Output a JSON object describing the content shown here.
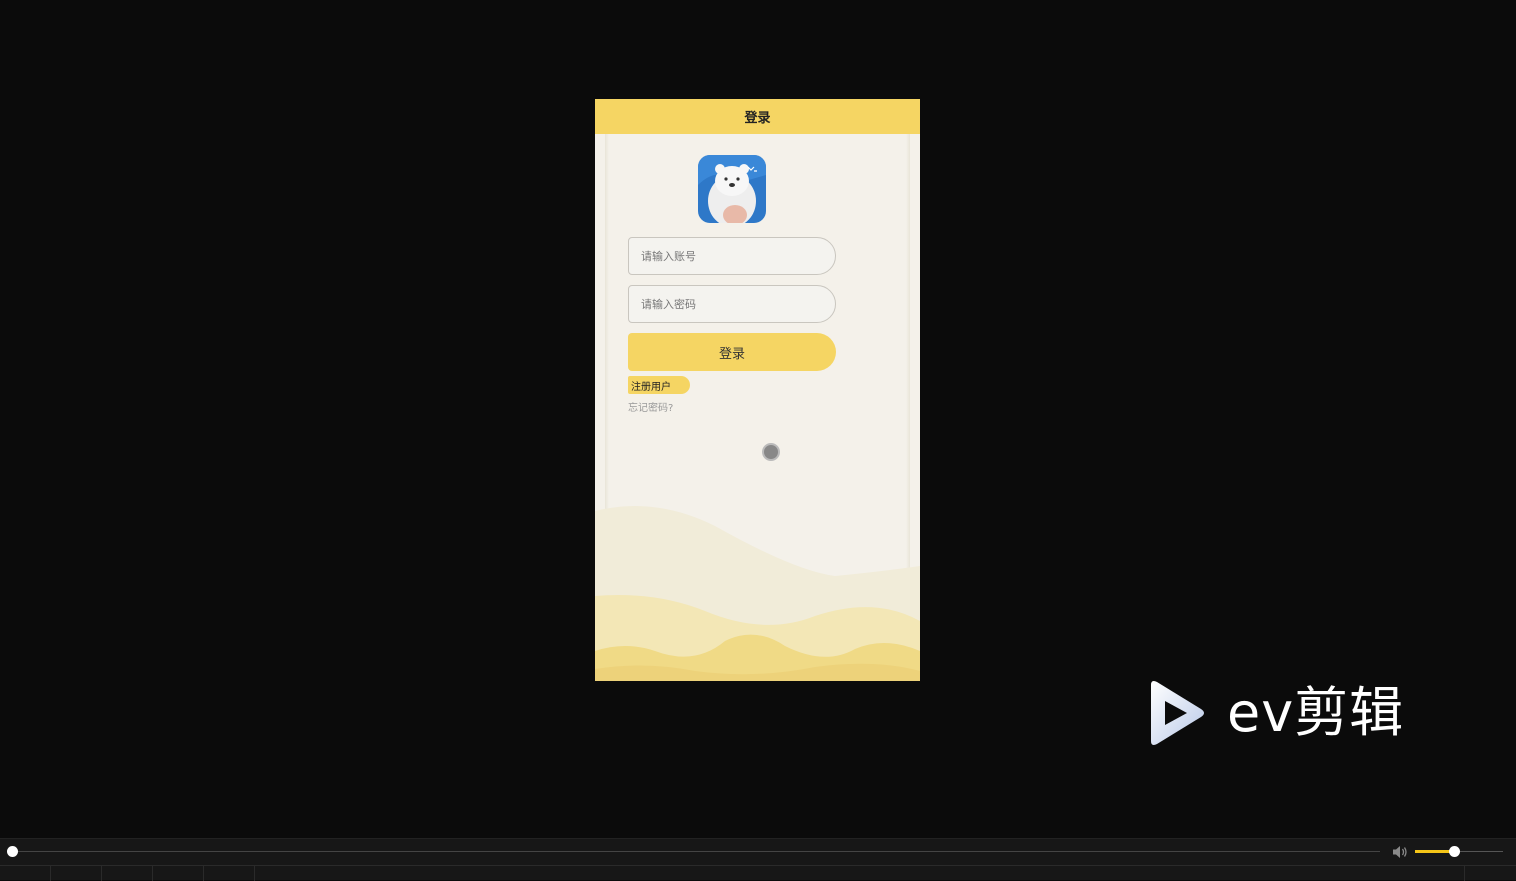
{
  "app": {
    "header_title": "登录",
    "account_placeholder": "请输入账号",
    "password_placeholder": "请输入密码",
    "login_label": "登录",
    "register_label": "注册用户",
    "forgot_label": "忘记密码?",
    "accent_color": "#f5d563",
    "avatar_icon": "polar-bear-icon"
  },
  "watermark": {
    "text": "ev剪辑",
    "logo_icon": "play-triangle-icon"
  },
  "player": {
    "progress_fraction": 0.0,
    "volume_fraction": 0.44,
    "volume_icon": "speaker-icon",
    "accent_color": "#f5c518"
  }
}
